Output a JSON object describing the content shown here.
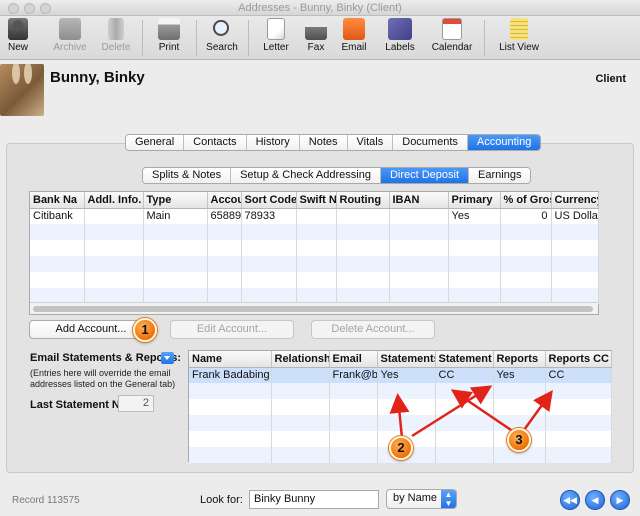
{
  "window": {
    "title": "Addresses - Bunny, Binky (Client)"
  },
  "toolbar": {
    "items": [
      {
        "label": "New",
        "icon": "new-contact-icon",
        "enabled": true
      },
      {
        "label": "Archive",
        "icon": "archive-icon",
        "enabled": false
      },
      {
        "label": "Delete",
        "icon": "trash-icon",
        "enabled": false
      },
      {
        "label": "Print",
        "icon": "printer-icon",
        "enabled": true
      },
      {
        "label": "Search",
        "icon": "search-icon",
        "enabled": true
      },
      {
        "label": "Letter",
        "icon": "letter-icon",
        "enabled": true
      },
      {
        "label": "Fax",
        "icon": "fax-icon",
        "enabled": true
      },
      {
        "label": "Email",
        "icon": "email-icon",
        "enabled": true
      },
      {
        "label": "Labels",
        "icon": "labels-icon",
        "enabled": true
      },
      {
        "label": "Calendar",
        "icon": "calendar-icon",
        "enabled": true
      },
      {
        "label": "List View",
        "icon": "list-view-icon",
        "enabled": true
      }
    ]
  },
  "contact": {
    "name": "Bunny, Binky",
    "type": "Client"
  },
  "main_tabs": [
    "General",
    "Contacts",
    "History",
    "Notes",
    "Vitals",
    "Documents",
    "Accounting"
  ],
  "main_tabs_active": "Accounting",
  "sub_tabs": [
    "Splits & Notes",
    "Setup & Check Addressing",
    "Direct Deposit",
    "Earnings"
  ],
  "sub_tabs_active": "Direct Deposit",
  "accounts_table": {
    "columns": [
      "Bank Na",
      "Addl. Info.",
      "Type",
      "Accour",
      "Sort Code",
      "Swift N",
      "Routing",
      "IBAN",
      "Primary",
      "% of Gros",
      "Currency"
    ],
    "rows": [
      [
        "Citibank",
        "",
        "Main",
        "65889",
        "78933",
        "",
        "",
        "",
        "Yes",
        "0",
        "US Dollar"
      ]
    ]
  },
  "buttons": {
    "add_account": "Add Account...",
    "edit_account": "Edit Account...",
    "delete_account": "Delete Account..."
  },
  "email_section": {
    "label": "Email Statements & Reports:",
    "note_line1": "(Entries here will override the email",
    "note_line2": "addresses listed on the General tab)",
    "last_statement_label": "Last Statement No:",
    "last_statement_value": "2"
  },
  "email_table": {
    "columns": [
      "Name",
      "Relationshi",
      "Email",
      "Statements",
      "Statement C",
      "Reports",
      "Reports CC"
    ],
    "rows": [
      [
        "Frank Badabing",
        "",
        "Frank@bi",
        "Yes",
        "CC",
        "Yes",
        "CC"
      ]
    ]
  },
  "callouts": [
    "1",
    "2",
    "3"
  ],
  "footer": {
    "record": "Record 113575",
    "look_for_label": "Look for:",
    "look_for_value": "Binky Bunny",
    "sort_select": "by Name"
  }
}
